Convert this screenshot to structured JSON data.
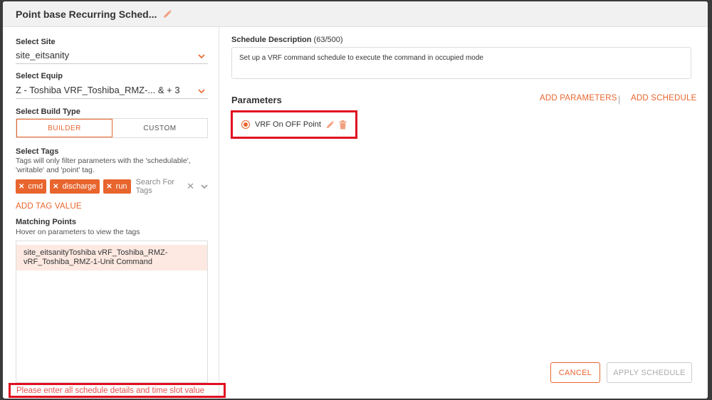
{
  "dialog": {
    "title": "Point base Recurring Sched...",
    "title_edit_icon": "pencil-icon"
  },
  "left": {
    "site": {
      "label": "Select Site",
      "value": "site_eitsanity"
    },
    "equip": {
      "label": "Select Equip",
      "value": "Z - Toshiba VRF_Toshiba_RMZ-... & + 3"
    },
    "build_type": {
      "label": "Select Build Type",
      "options": [
        "BUILDER",
        "CUSTOM"
      ],
      "selected": "BUILDER"
    },
    "tags": {
      "label": "Select Tags",
      "help": "Tags will only filter parameters with the 'schedulable', 'writable' and 'point' tag.",
      "chips": [
        "cmd",
        "discharge",
        "run"
      ],
      "search_placeholder": "Search For Tags",
      "add_tag_value": "ADD TAG VALUE"
    },
    "matching": {
      "label": "Matching Points",
      "help": "Hover on parameters to view the tags",
      "items": [
        "site_eitsanityToshiba vRF_Toshiba_RMZ-vRF_Toshiba_RMZ-1-Unit Command"
      ]
    },
    "error": "Please enter all schedule details and time slot value"
  },
  "right": {
    "description": {
      "label": "Schedule Description",
      "count": "(63/500)",
      "value": "Set up a VRF command schedule to execute the command in occupied mode"
    },
    "parameters": {
      "title": "Parameters",
      "add_parameters": "ADD PARAMETERS",
      "separator": "|",
      "add_schedule": "ADD SCHEDULE",
      "items": [
        {
          "name": "VRF On OFF Point"
        }
      ]
    },
    "buttons": {
      "cancel": "CANCEL",
      "apply": "APPLY SCHEDULE"
    }
  },
  "colors": {
    "accent": "#e8652e",
    "error_border": "#e01020",
    "error_text": "#e8524e"
  }
}
